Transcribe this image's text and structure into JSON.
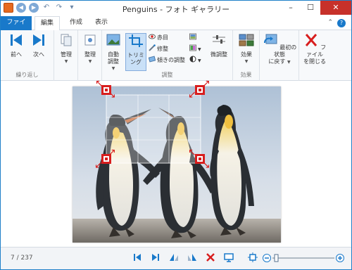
{
  "window": {
    "title": "Penguins - フォト ギャラリー"
  },
  "tabs": {
    "file": "ファイル",
    "edit": "編集",
    "create": "作成",
    "view": "表示"
  },
  "ribbon": {
    "repeat_group": {
      "prev_label": "前へ",
      "next_label": "次へ",
      "group_label": "繰り返し"
    },
    "manage_label": "管理",
    "organize_label": "整理",
    "adjust_group": {
      "auto_adjust_label": "自動\n調整",
      "trim_label": "トリミ\nング",
      "red_eye_label": "赤目",
      "retouch_label": "修整",
      "straighten_label": "傾きの調整",
      "fine_tune_label": "微調整",
      "group_label": "調整"
    },
    "effects_group": {
      "effects_label": "効果",
      "group_label": "効果"
    },
    "revert_label": "最初の状態\nに戻す",
    "close_file_label": "ファイル\nを閉じる"
  },
  "status": {
    "counter": "7 / 237"
  },
  "colors": {
    "accent": "#1979ca",
    "crop_handle": "#d81e1e",
    "close": "#c7312a"
  }
}
